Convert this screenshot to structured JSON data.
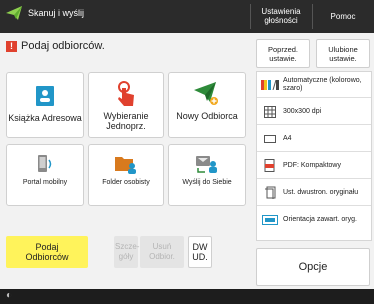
{
  "header": {
    "title": "Skanuj i wyślij",
    "right_buttons": [
      "Ustawienia głośności",
      "Pomoc"
    ]
  },
  "main": {
    "prompt": "Podaj odbiorców."
  },
  "recipient_tiles": [
    {
      "label": "Książka Adresowa",
      "icon": "address-book-icon"
    },
    {
      "label": "Wybieranie Jednoprz.",
      "icon": "one-touch-hand-icon"
    },
    {
      "label": "Nowy Odbiorca",
      "icon": "new-recipient-plane-icon"
    },
    {
      "label": "Portal mobilny",
      "icon": "mobile-portal-icon"
    },
    {
      "label": "Folder osobisty",
      "icon": "personal-folder-icon"
    },
    {
      "label": "Wyślij do Siebie",
      "icon": "send-to-myself-icon"
    }
  ],
  "bottom_row": {
    "specify": "Podaj Odbiorców",
    "details": "Szcze-góły",
    "delete": "Usuń Odbior.",
    "dw_ud": "DW UD."
  },
  "top_right": {
    "previous_settings": "Poprzed. ustawie.",
    "favorite_settings": "Ulubione ustawie."
  },
  "settings": [
    {
      "text": "Automatyczne (kolorowo, szaro)",
      "icon": "color-mode-icon"
    },
    {
      "text": "300x300 dpi",
      "icon": "resolution-icon"
    },
    {
      "text": "A4",
      "icon": "paper-size-icon"
    },
    {
      "text": "PDF: Kompaktowy",
      "icon": "file-format-icon"
    },
    {
      "text": "Ust. dwustron. oryginału",
      "icon": "duplex-original-icon"
    },
    {
      "text": "Orientacja zawart. oryg.",
      "icon": "orientation-icon"
    }
  ],
  "options_button": "Opcje",
  "colors": {
    "topbar": "#2b2b2b",
    "active_button": "#fff35b",
    "warning": "#e0412e",
    "accent_blue": "#2196c8",
    "accent_green": "#2e8b3a"
  }
}
